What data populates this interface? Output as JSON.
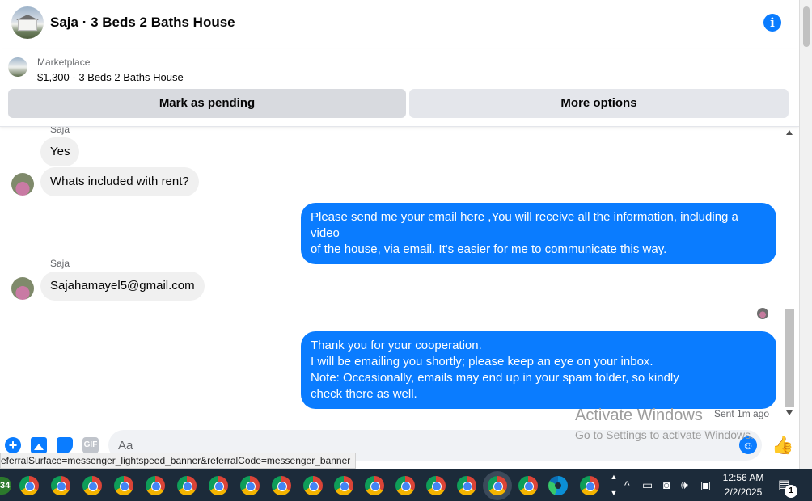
{
  "header": {
    "title": "Saja · 3 Beds 2 Baths House",
    "info_glyph": "i"
  },
  "listing": {
    "category": "Marketplace",
    "name": "$1,300 - 3 Beds 2 Baths House",
    "mark_pending_label": "Mark as pending",
    "more_options_label": "More options"
  },
  "messages": {
    "sender_1": "Saja",
    "m1": "Yes",
    "m2": "Whats included with rent?",
    "out1_line1": "Please send me your email here ,You will receive all the information, including a video",
    "out1_line2": "of the house, via email. It's easier for me to communicate this way.",
    "sender_2": "Saja",
    "m3": "Sajahamayel5@gmail.com",
    "out2_line1": "Thank you for your cooperation.",
    "out2_line2": "I will be emailing you shortly; please keep an eye on your inbox.",
    "out2_line3": "Note: Occasionally, emails may end up in your spam folder, so kindly",
    "out2_line4": "check there as well.",
    "sent_status": "Sent 1m ago"
  },
  "watermark": {
    "line1": "Activate Windows",
    "line2": "Go to Settings to activate Windows."
  },
  "composer": {
    "placeholder": "Aa",
    "gif_label": "GIF"
  },
  "status_url": "eferralSurface=messenger_lightspeed_banner&referralCode=messenger_banner",
  "taskbar": {
    "badge": "34",
    "time": "12:56 AM",
    "date": "2/2/2025",
    "notification_count": "1"
  },
  "colors": {
    "accent": "#0a7cff",
    "bubble_in": "#f0f0f0",
    "taskbar": "#1c2b3a"
  }
}
